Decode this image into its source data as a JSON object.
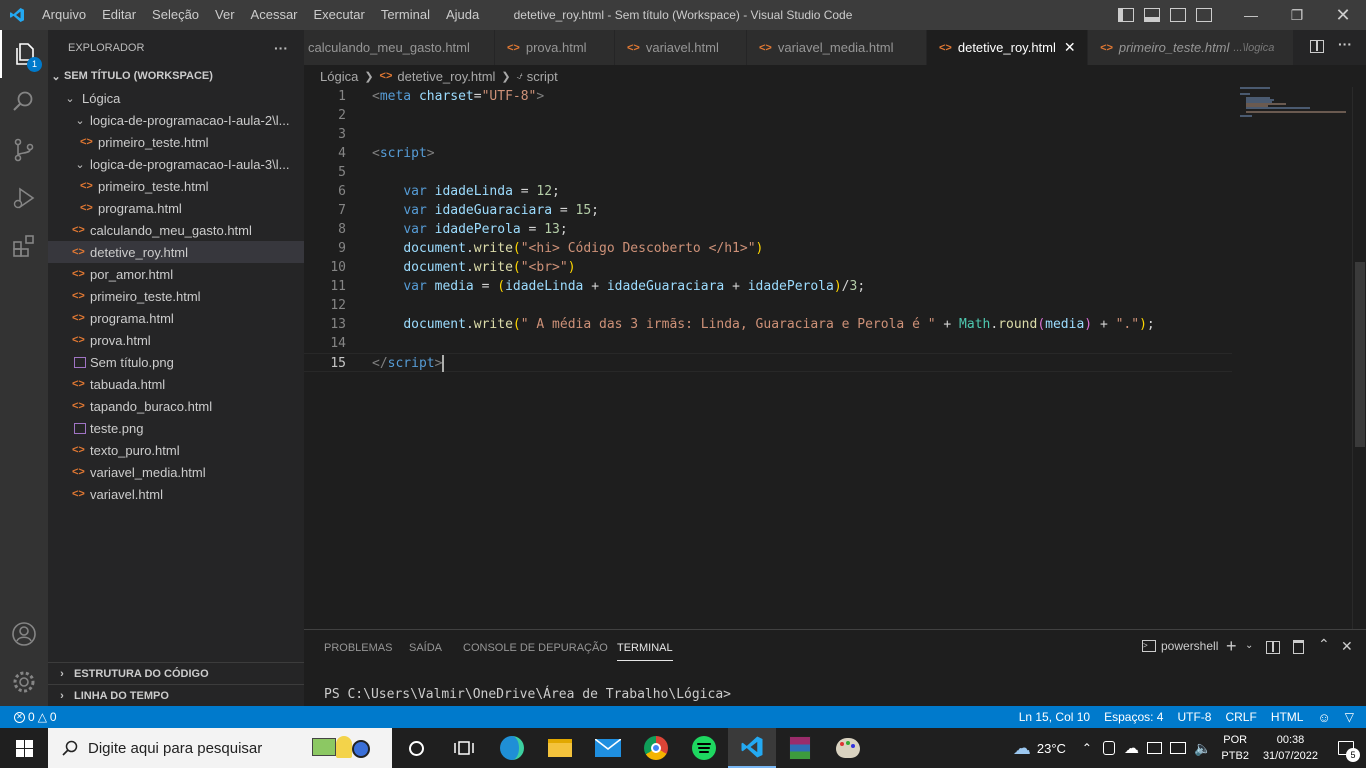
{
  "window": {
    "title": "detetive_roy.html - Sem título (Workspace) - Visual Studio Code",
    "menu": [
      "Arquivo",
      "Editar",
      "Seleção",
      "Ver",
      "Acessar",
      "Executar",
      "Terminal",
      "Ajuda"
    ]
  },
  "activity": {
    "explorer_badge": "1"
  },
  "sidebar": {
    "header": "EXPLORADOR",
    "more": "···",
    "workspace": "SEM TÍTULO (WORKSPACE)",
    "root_folder": "Lógica",
    "tree": [
      {
        "label": "logica-de-programacao-I-aula-2\\l...",
        "type": "folder"
      },
      {
        "label": "primeiro_teste.html",
        "type": "html"
      },
      {
        "label": "logica-de-programacao-I-aula-3\\l...",
        "type": "folder"
      },
      {
        "label": "primeiro_teste.html",
        "type": "html"
      },
      {
        "label": "programa.html",
        "type": "html"
      },
      {
        "label": "calculando_meu_gasto.html",
        "type": "html"
      },
      {
        "label": "detetive_roy.html",
        "type": "html"
      },
      {
        "label": "por_amor.html",
        "type": "html"
      },
      {
        "label": "primeiro_teste.html",
        "type": "html"
      },
      {
        "label": "programa.html",
        "type": "html"
      },
      {
        "label": "prova.html",
        "type": "html"
      },
      {
        "label": "Sem título.png",
        "type": "png"
      },
      {
        "label": "tabuada.html",
        "type": "html"
      },
      {
        "label": "tapando_buraco.html",
        "type": "html"
      },
      {
        "label": "teste.png",
        "type": "png"
      },
      {
        "label": "texto_puro.html",
        "type": "html"
      },
      {
        "label": "variavel_media.html",
        "type": "html"
      },
      {
        "label": "variavel.html",
        "type": "html"
      }
    ],
    "outline": "ESTRUTURA DO CÓDIGO",
    "timeline": "LINHA DO TEMPO"
  },
  "tabs": [
    {
      "label": "calculando_meu_gasto.html"
    },
    {
      "label": "prova.html"
    },
    {
      "label": "variavel.html"
    },
    {
      "label": "variavel_media.html"
    },
    {
      "label": "detetive_roy.html"
    },
    {
      "label": "primeiro_teste.html",
      "suffix": "...\\logica"
    }
  ],
  "breadcrumb": [
    "Lógica",
    "detetive_roy.html",
    "script"
  ],
  "editor": {
    "line_numbers": [
      "1",
      "2",
      "3",
      "4",
      "5",
      "6",
      "7",
      "8",
      "9",
      "10",
      "11",
      "12",
      "13",
      "14",
      "15"
    ],
    "code": {
      "l1_tag": "meta",
      "l1_attr": "charset",
      "l1_val": "\"UTF-8\"",
      "l4_tag": "script",
      "l6_var": "idadeLinda",
      "l6_num": "12",
      "l7_var": "idadeGuaraciara",
      "l7_num": "15",
      "l8_var": "idadePerola",
      "l8_num": "13",
      "kw_var": "var",
      "doc": "document",
      "write": "write",
      "l9_str": "\"<hi> Código Descoberto </h1>\"",
      "l10_str": "\"<br>\"",
      "l11_var": "media",
      "l11_a": "idadeLinda",
      "l11_b": "idadeGuaraciara",
      "l11_c": "idadePerola",
      "l11_num": "3",
      "l13_str": "\" A média das 3 irmãs: Linda, Guaraciara e Perola é \"",
      "l13_math": "Math",
      "l13_round": "round",
      "l13_media": "media",
      "l13_dot": "\".\"",
      "l15_tag": "script"
    }
  },
  "panel": {
    "tabs": [
      "PROBLEMAS",
      "SAÍDA",
      "CONSOLE DE DEPURAÇÃO",
      "TERMINAL"
    ],
    "shell": "powershell",
    "prompt": "PS C:\\Users\\Valmir\\OneDrive\\Área de Trabalho\\Lógica>"
  },
  "statusbar": {
    "errors": "0",
    "warnings": "0",
    "position": "Ln 15, Col 10",
    "spaces": "Espaços: 4",
    "encoding": "UTF-8",
    "eol": "CRLF",
    "language": "HTML"
  },
  "taskbar": {
    "search_placeholder": "Digite aqui para pesquisar",
    "temperature": "23°C",
    "lang1": "POR",
    "lang2": "PTB2",
    "time": "00:38",
    "date": "31/07/2022",
    "notif_count": "5"
  },
  "colors": {
    "accent": "#007acc",
    "active_tab": "#1e1e1e",
    "sidebar": "#252526"
  }
}
